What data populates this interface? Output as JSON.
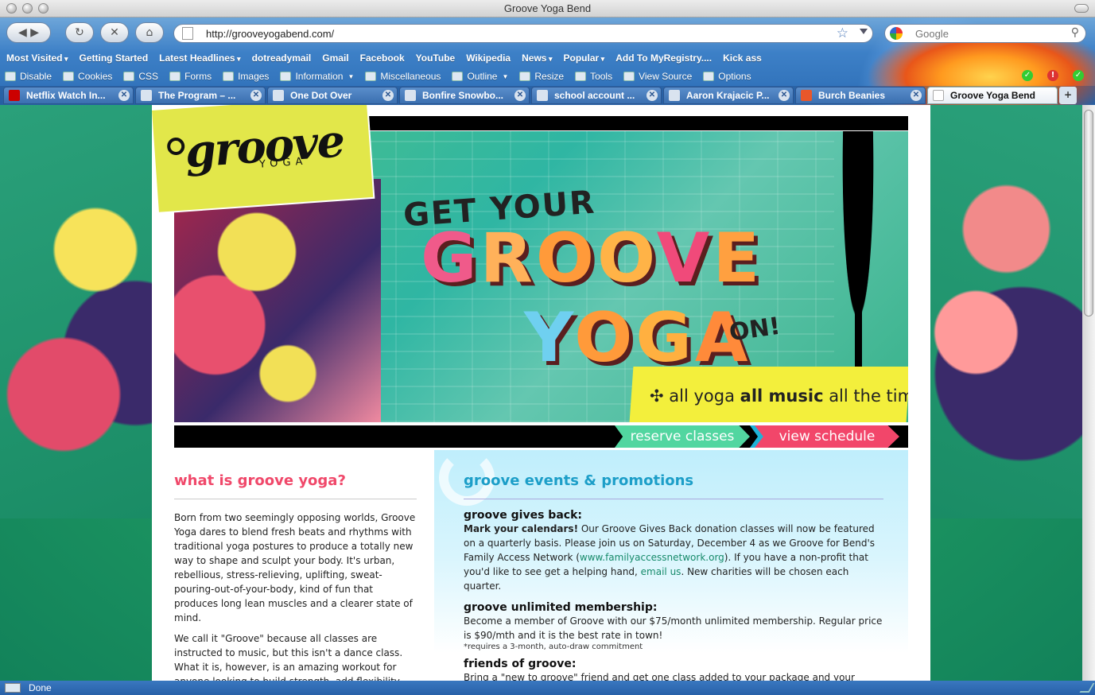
{
  "window": {
    "title": "Groove Yoga Bend"
  },
  "nav": {
    "url": "http://grooveyogabend.com/",
    "search_placeholder": "Google"
  },
  "bookmarks": [
    "Most Visited",
    "Getting Started",
    "Latest Headlines",
    "dotreadymail",
    "Gmail",
    "Facebook",
    "YouTube",
    "Wikipedia",
    "News",
    "Popular",
    "Add To MyRegistry....",
    "Kick ass"
  ],
  "devtools": [
    "Disable",
    "Cookies",
    "CSS",
    "Forms",
    "Images",
    "Information",
    "Miscellaneous",
    "Outline",
    "Resize",
    "Tools",
    "View Source",
    "Options"
  ],
  "tabs": [
    "Netflix Watch In...",
    "The Program – ...",
    "One Dot Over",
    "Bonfire Snowbo...",
    "school account ...",
    "Aaron Krajacic P...",
    "Burch Beanies",
    "Groove Yoga Bend"
  ],
  "icons": {
    "back": "back-arrow-icon",
    "forward": "forward-arrow-icon",
    "reload": "reload-icon",
    "stop": "stop-icon",
    "home": "home-icon",
    "bookmark": "star-icon",
    "search": "magnifier-icon"
  },
  "site": {
    "logo": {
      "word": "groove",
      "sub": "YOGA"
    },
    "banner": {
      "line1": "GET YOUR",
      "line2": "GROOVE",
      "line3": "YOGA",
      "line4": "ON!",
      "tag_pre": "all yoga ",
      "tag_bold": "all music",
      "tag_post": " all the time"
    },
    "nav": {
      "reserve": "reserve classes",
      "schedule": "view schedule"
    },
    "left": {
      "heading": "what is groove yoga?",
      "p1": "Born from two seemingly opposing worlds, Groove Yoga dares to blend fresh beats and rhythms with traditional yoga postures to produce a totally new way to shape and sculpt your body. It's urban, rebellious, stress-relieving, uplifting, sweat-pouring-out-of-your-body, kind of fun that produces long lean muscles and a clearer state of mind.",
      "p2": "We call it \"Groove\" because all classes are instructed to music, but this isn't a dance class. What it is, however, is an amazing workout for anyone looking to build strength, add flexibility"
    },
    "right": {
      "heading": "groove events & promotions",
      "e1_title": "groove gives back:",
      "e1_bold": "Mark your calendars!",
      "e1_text": " Our Groove Gives Back donation classes will now be featured on a quarterly basis. Please join us on Saturday, December 4 as we Groove for Bend's Family Access Network (",
      "e1_link": "www.familyaccessnetwork.org",
      "e1_text2": "). If you have a non-profit that you'd like to see get a helping hand, ",
      "e1_link2": "email us",
      "e1_text3": ". New charities will be chosen each quarter.",
      "e2_title": "groove unlimited membership:",
      "e2_text": "Become a member of Groove with our $75/month unlimited membership. Regular price is $90/mth and it is the best rate in town!",
      "e2_note": "*requires a 3-month, auto-draw commitment",
      "e3_title": "friends of groove:",
      "e3_text": "Bring a \"new to groove\" friend and get one class added to your package and your friend practices for free that class. You must attend with your friend to receive the promotion."
    }
  },
  "status": {
    "text": "Done"
  }
}
